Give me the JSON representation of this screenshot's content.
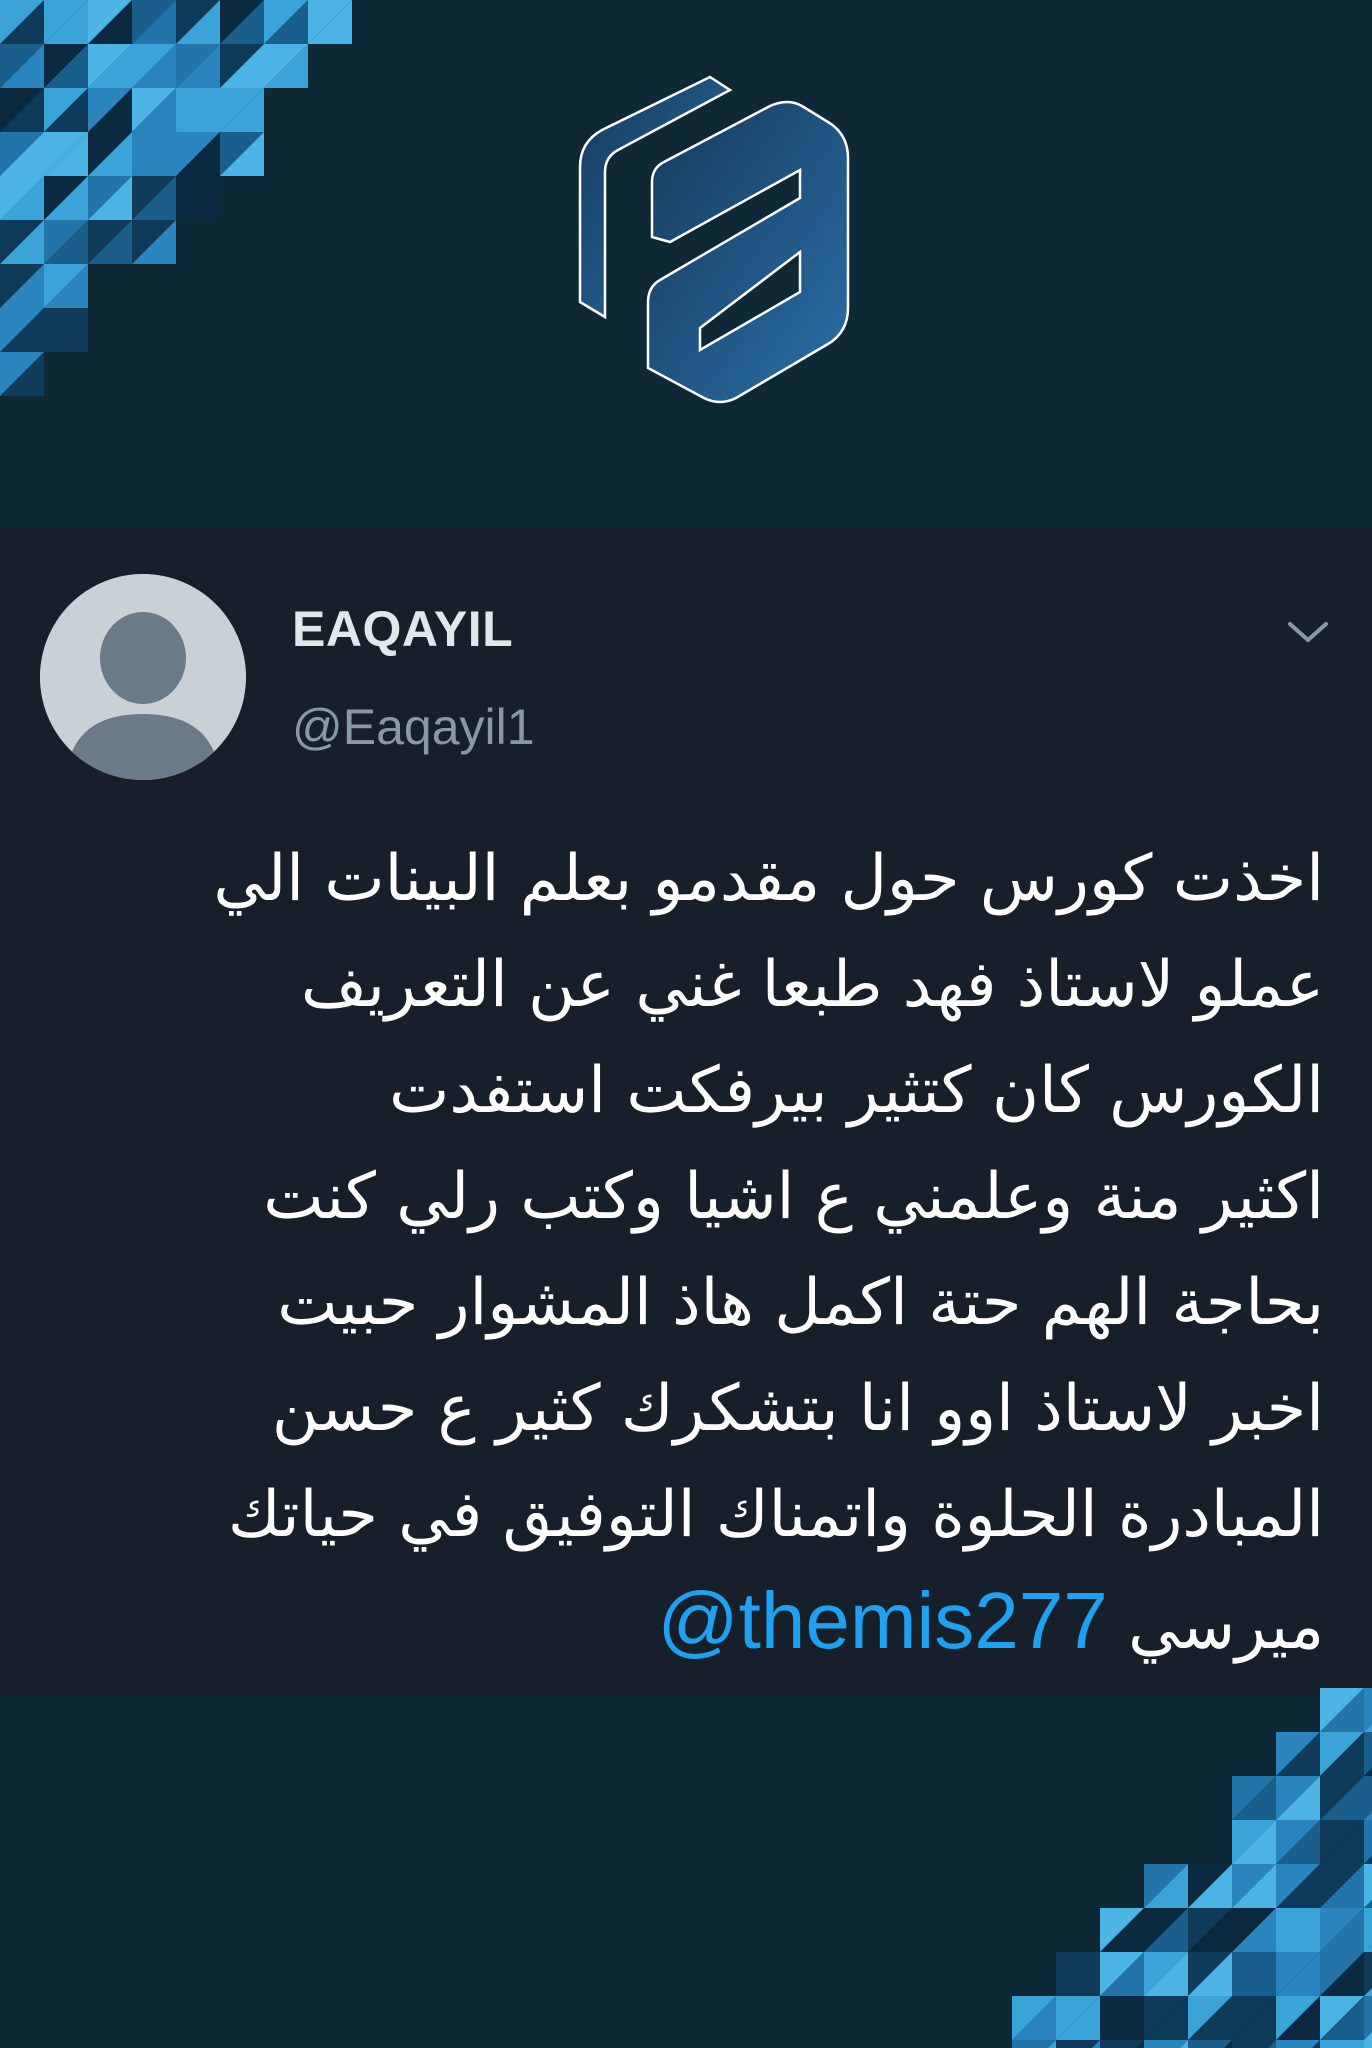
{
  "colors": {
    "background": "#0e2836",
    "card": "#17202a",
    "name": "#e1e8ed",
    "handle": "#8899a6",
    "text": "#ffffff",
    "link": "#1da1f2"
  },
  "brand": {
    "logo_icon": "fa-hexagon-logo-icon"
  },
  "tweet": {
    "author": {
      "display_name": "EAQAYIL",
      "handle": "@Eaqayil1",
      "avatar_icon": "default-user-avatar-icon"
    },
    "menu_icon": "chevron-down-icon",
    "lines": [
      "اخذت كورس حول مقدمو بعلم البينات الي",
      "عملو لاستاذ فهد طبعا غني عن التعريف",
      "الكورس كان كتثير بيرفكت استفدت",
      "اكثير منة  وعلمني ع اشيا وكتب رلي كنت",
      "بحاجة الهم حتة اكمل  هاذ المشوار حبيت",
      "اخبر لاستاذ اوو انا بتشكرك  كثير ع حسن",
      "المبادرة الحلوة واتمناك التوفيق في حياتك"
    ],
    "last_line_text": "ميرسي",
    "mention": "@themis277"
  }
}
